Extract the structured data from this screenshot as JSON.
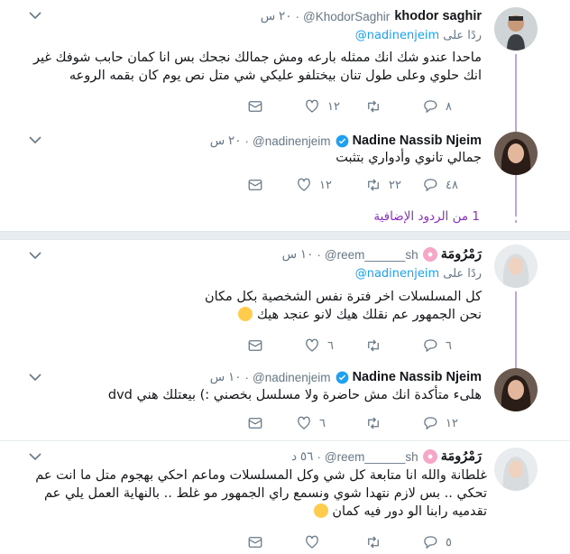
{
  "tweets": [
    {
      "name": "khodor saghir",
      "handle": "@KhodorSaghir",
      "time": "٢٠ س",
      "replying_label": "ردًا على",
      "replying_to": "@nadinenjeim",
      "text": "ماحدا عندو شك انك ممثله بارعه ومش جمالك نجحك بس انا كمان حابب شوفك غير انك حلوي وعلى طول تنان بيختلفو عليكي شي متل نص يوم كان بقمه الروعه",
      "replies": "٨",
      "retweets": "",
      "likes": "١٢"
    },
    {
      "name": "Nadine Nassib Njeim",
      "handle": "@nadinenjeim",
      "time": "٢٠ س",
      "verified": true,
      "text": "جمالي تانوي وأدواري بتثبت",
      "replies": "٤٨",
      "retweets": "٢٢",
      "likes": "١٢"
    },
    {
      "name": "رَمْرُومَة",
      "handle": "@reem______sh",
      "time": "١٠ س",
      "replying_label": "ردًا على",
      "replying_to": "@nadinenjeim",
      "text_line1": "كل المسلسلات اخر فترة نفس الشخصية بكل مكان",
      "text_line2": "نحن الجمهور عم نقلك هيك لانو عنجد هيك",
      "replies": "٦",
      "retweets": "",
      "likes": "٦"
    },
    {
      "name": "Nadine Nassib Njeim",
      "handle": "@nadinenjeim",
      "time": "١٠ س",
      "verified": true,
      "text": "هلىء متأكدة انك مش حاضرة ولا مسلسل بخصني :) بيعتلك هني dvd",
      "replies": "١٢",
      "retweets": "",
      "likes": "٦"
    },
    {
      "name": "رَمْرُومَة",
      "handle": "@reem______sh",
      "time": "٥٦ د",
      "text": "غلطانة والله انا متابعة كل شي وكل المسلسلات وماعم احكي بهجوم متل ما انت عم تحكي .. بس لازم نتهدا شوي ونسمع راي الجمهور مو غلط .. بالنهاية العمل يلي عم تقدميه رابنا الو دور فيه كمان",
      "replies": "٥",
      "retweets": "",
      "likes": ""
    }
  ],
  "more_replies": "1 من الردود الإضافية",
  "colors": {
    "accent": "#1da1f2",
    "thread": "#c8a2d6",
    "more": "#8a2ec2",
    "muted": "#657786"
  },
  "icons": [
    "reply-icon",
    "retweet-icon",
    "like-icon",
    "dm-icon",
    "caret-down-icon",
    "verified-icon",
    "flower-emoji",
    "worried-emoji",
    "kiss-emoji"
  ]
}
